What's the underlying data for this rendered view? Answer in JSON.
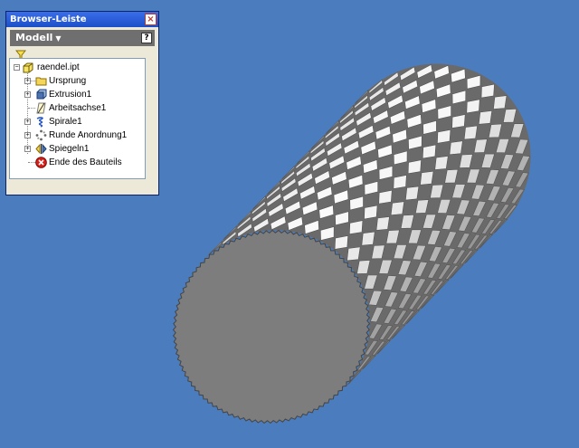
{
  "panel": {
    "title": "Browser-Leiste",
    "close_glyph": "×",
    "mode_label": "Modell",
    "help_glyph": "?",
    "filter_icon": "filter-icon"
  },
  "tree": {
    "root": {
      "label": "raendel.ipt",
      "icon": "part-icon"
    },
    "items": [
      {
        "label": "Ursprung",
        "icon": "folder-icon",
        "expander": "+"
      },
      {
        "label": "Extrusion1",
        "icon": "extrusion-icon",
        "expander": "+"
      },
      {
        "label": "Arbeitsachse1",
        "icon": "work-axis-icon",
        "expander": ""
      },
      {
        "label": "Spirale1",
        "icon": "coil-icon",
        "expander": "+"
      },
      {
        "label": "Runde Anordnung1",
        "icon": "circular-pattern-icon",
        "expander": "+"
      },
      {
        "label": "Spiegeln1",
        "icon": "mirror-icon",
        "expander": "+"
      },
      {
        "label": "Ende des Bauteils",
        "icon": "end-of-part-icon",
        "expander": ""
      }
    ]
  },
  "colors": {
    "viewport_background": "#4b7dbe",
    "face": "#7d7d7d",
    "knurl_light": "#f4f4f4",
    "knurl_dark": "#8e8e8e"
  }
}
